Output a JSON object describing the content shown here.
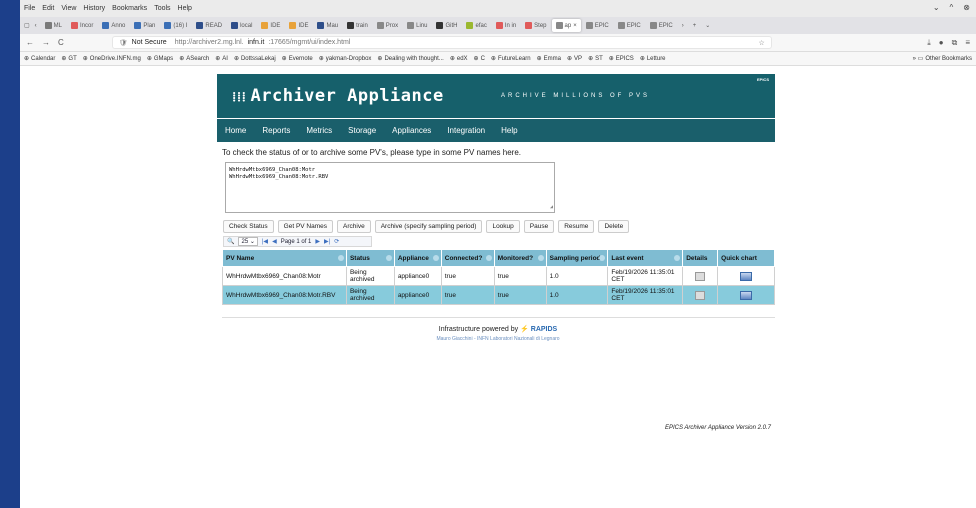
{
  "browser": {
    "menu": [
      "File",
      "Edit",
      "View",
      "History",
      "Bookmarks",
      "Tools",
      "Help"
    ],
    "tabs": [
      {
        "label": "ML",
        "color": "#7a7a7a"
      },
      {
        "label": "Incor",
        "color": "#e05a5a"
      },
      {
        "label": "Anno",
        "color": "#3b6fb6"
      },
      {
        "label": "Plan",
        "color": "#3b6fb6"
      },
      {
        "label": "(16) I",
        "color": "#3b6fb6"
      },
      {
        "label": "READ",
        "color": "#2e4e8a"
      },
      {
        "label": "local",
        "color": "#2e4e8a"
      },
      {
        "label": "IDE",
        "color": "#e8a23a"
      },
      {
        "label": "IDE",
        "color": "#e8a23a"
      },
      {
        "label": "Mau",
        "color": "#2e4e8a"
      },
      {
        "label": "train",
        "color": "#333333"
      },
      {
        "label": "Prox",
        "color": "#888888"
      },
      {
        "label": "Linu",
        "color": "#888888"
      },
      {
        "label": "GitH",
        "color": "#333333"
      },
      {
        "label": "efac",
        "color": "#9bb830"
      },
      {
        "label": "In in",
        "color": "#e05a5a"
      },
      {
        "label": "Step",
        "color": "#e05a5a"
      },
      {
        "label": "ap",
        "color": "#888888",
        "active": true
      },
      {
        "label": "EPIC",
        "color": "#888888"
      },
      {
        "label": "EPIC",
        "color": "#888888"
      },
      {
        "label": "EPIC",
        "color": "#888888"
      }
    ],
    "url_prefix": "Not Secure",
    "url_scheme": "http://archiver2.mg.lnl.",
    "url_host": "infn.it",
    "url_path": ":17665/mgmt/ui/index.html",
    "bookmarks": [
      "Calendar",
      "GT",
      "OneDrive.INFN.mg",
      "GMaps",
      "ASearch",
      "AI",
      "DottssaLekaj",
      "Evernote",
      "yakman-Dropbox",
      "Dealing with thought...",
      "edX",
      "C",
      "FutureLearn",
      "Emma",
      "VP",
      "ST",
      "EPICS",
      "Letture"
    ],
    "other_bookmarks": "Other Bookmarks"
  },
  "header": {
    "title": "Archiver Appliance",
    "tagline": "ARCHIVE MILLIONS OF PVS",
    "logo_text": "EPICS"
  },
  "nav": [
    "Home",
    "Reports",
    "Metrics",
    "Storage",
    "Appliances",
    "Integration",
    "Help"
  ],
  "intro": "To check the status of or to archive some PV's, please type in some PV names here.",
  "pv_input": "WhHrdwMtbx6969_Chan08:Motr\nWhHrdwMtbx6969_Chan08:Motr.RBV",
  "buttons": [
    "Check Status",
    "Get PV Names",
    "Archive",
    "Archive (specify sampling period)",
    "Lookup",
    "Pause",
    "Resume",
    "Delete"
  ],
  "pager": {
    "page_size": "25",
    "page_text": "Page 1 of 1"
  },
  "table": {
    "headers": [
      "PV Name",
      "Status",
      "Appliance",
      "Connected?",
      "Monitored?",
      "Sampling period",
      "Last event",
      "Details",
      "Quick chart"
    ],
    "rows": [
      [
        "WhHrdwMtbx6969_Chan08:Motr",
        "Being archived",
        "appliance0",
        "true",
        "true",
        "1.0",
        "Feb/19/2026 11:35:01 CET"
      ],
      [
        "WhHrdwMtbx6969_Chan08:Motr.RBV",
        "Being archived",
        "appliance0",
        "true",
        "true",
        "1.0",
        "Feb/19/2026 11:35:01 CET"
      ]
    ]
  },
  "footer": {
    "powered": "Infrastructure powered by",
    "rapids": "RAPIDS",
    "credit": "Mauro Giacchini - INFN Laboratori Nazionali di Legnaro",
    "version": "EPICS Archiver Appliance Version 2.0.7"
  }
}
